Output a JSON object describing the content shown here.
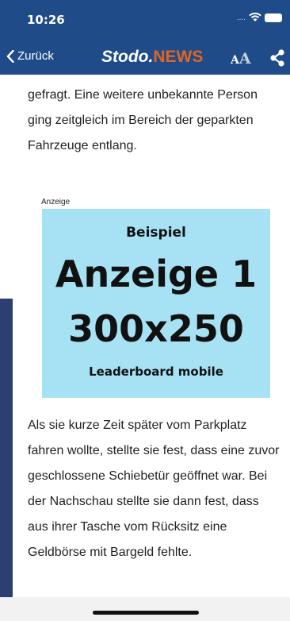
{
  "status_bar": {
    "time": "10:26",
    "signal": "....",
    "icons": [
      "wifi-icon",
      "battery-icon"
    ]
  },
  "navbar": {
    "back_label": "Zurück",
    "brand_part1": "Stodo.",
    "brand_part2": "NEWS",
    "font_small": "A",
    "font_big": "A",
    "share_icon": "share-icon",
    "colors": {
      "bar": "#1f4c89",
      "accent": "#e0661f"
    }
  },
  "article": {
    "paragraph1": "gefragt. Eine weitere unbekannte Person ging zeitgleich im Bereich der geparkten Fahrzeuge entlang.",
    "paragraph2": "Als sie kurze Zeit später vom Parkplatz fahren wollte, stellte sie fest, dass eine zuvor geschlossene Schiebetür geöffnet war. Bei der Nachschau stellte sie dann fest, dass aus ihrer Tasche vom Rücksitz eine Geldbörse mit Bargeld fehlte."
  },
  "ad": {
    "label": "Anzeige",
    "line1": "Beispiel",
    "line2": "Anzeige 1",
    "line3": "300x250",
    "line4": "Leaderboard mobile",
    "background": "#a6e2f4"
  }
}
